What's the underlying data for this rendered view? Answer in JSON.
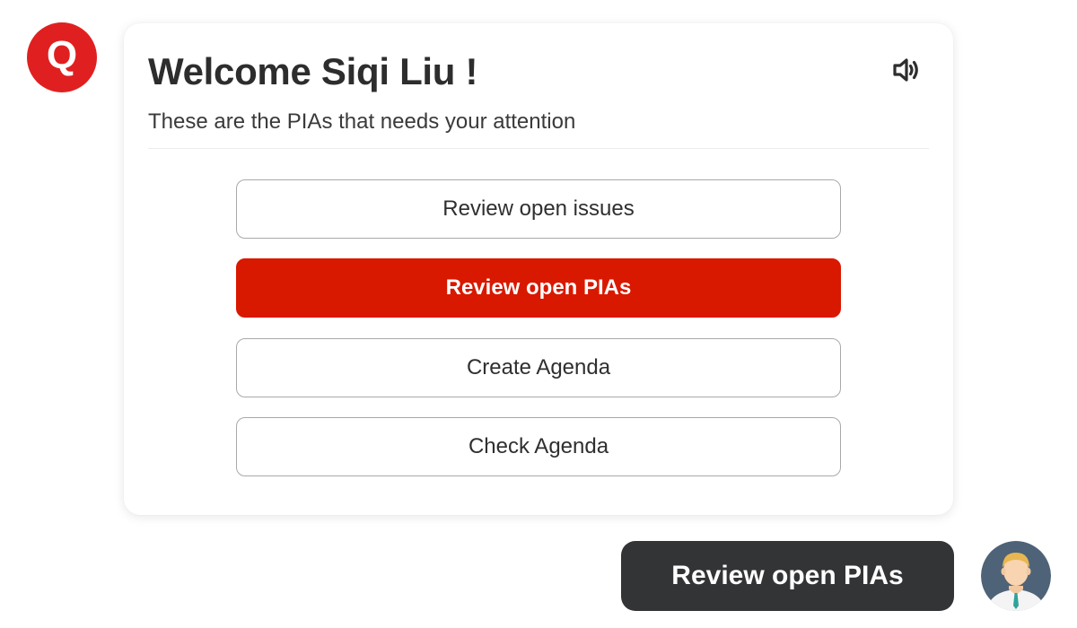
{
  "bot": {
    "avatar_letter": "Q",
    "avatar_color": "#e02020"
  },
  "card": {
    "title": "Welcome Siqi Liu !",
    "subtitle": "These are the PIAs that needs your attention",
    "speaker_icon": "speaker-volume-icon",
    "options": [
      {
        "label": "Review open issues",
        "selected": false
      },
      {
        "label": "Review open PIAs",
        "selected": true
      },
      {
        "label": "Create Agenda",
        "selected": false
      },
      {
        "label": "Check Agenda",
        "selected": false
      }
    ],
    "accent_color": "#d91800"
  },
  "user_message": {
    "text": "Review open PIAs",
    "bubble_color": "#333436"
  },
  "user": {
    "avatar_icon": "user-avatar-icon"
  }
}
